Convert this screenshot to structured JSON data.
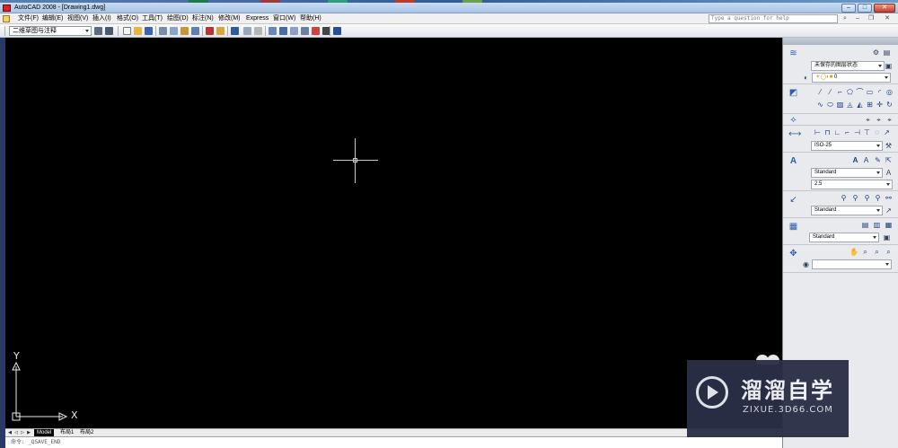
{
  "window": {
    "title": "AutoCAD 2008 - [Drawing1.dwg]",
    "minimize": "‒",
    "maximize": "□",
    "close": "✕"
  },
  "menu": {
    "items": [
      {
        "label": "文件(F)"
      },
      {
        "label": "编辑(E)"
      },
      {
        "label": "视图(V)"
      },
      {
        "label": "插入(I)"
      },
      {
        "label": "格式(O)"
      },
      {
        "label": "工具(T)"
      },
      {
        "label": "绘图(D)"
      },
      {
        "label": "标注(N)"
      },
      {
        "label": "修改(M)"
      },
      {
        "label": "Express"
      },
      {
        "label": "窗口(W)"
      },
      {
        "label": "帮助(H)"
      }
    ],
    "help_placeholder": "Type a question for help"
  },
  "toolbar": {
    "workspace": "二维草图与注释"
  },
  "drawing": {
    "ucs_y": "Y",
    "ucs_x": "X"
  },
  "layout_tabs": {
    "tabs": [
      "Model",
      "布局1",
      "布局2"
    ]
  },
  "command_line": {
    "text": "命令: _QSAVE_END"
  },
  "palette": {
    "layer_state": "未保存的图层状态",
    "layer_name": "0",
    "dim_style": "ISO-25",
    "text_style": "Standard",
    "text_height": "2.5",
    "mleader_style": "Standard",
    "table_style": "Standard",
    "visual_style": ""
  },
  "watermark": {
    "title": "溜溜自学",
    "url": "ZIXUE.3D66.COM"
  },
  "colors": {
    "drawing_bg": "#000000",
    "crosshair": "#c9c9c9",
    "titlebar": "#b7cfeb",
    "palette_bg": "#e9eaee",
    "watermark_bg": "#2a2f46"
  }
}
